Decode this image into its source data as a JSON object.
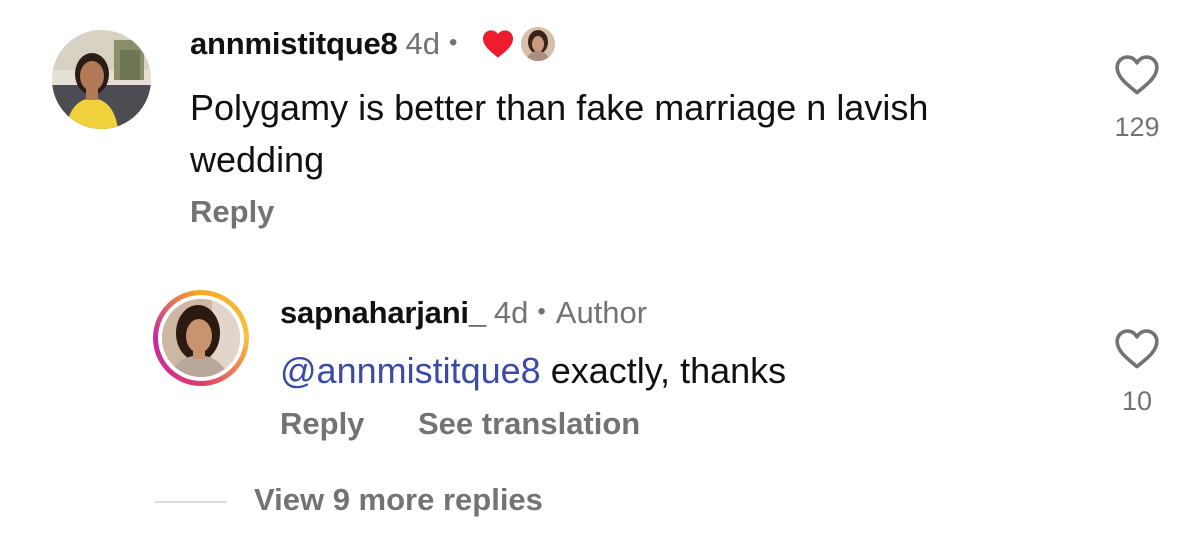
{
  "comments": [
    {
      "username": "annmistitque8",
      "age": "4d",
      "separator": "•",
      "text": "Polygamy is better than fake marriage n lavish wedding",
      "reply_label": "Reply",
      "like_count": "129",
      "badge_icon": "heart-icon",
      "accent_color": "#ed1c2e"
    }
  ],
  "reply": {
    "username": "sapnaharjani_",
    "age": "4d",
    "separator": "•",
    "role": "Author",
    "mention": "@annmistitque8",
    "text": " exactly, thanks",
    "reply_label": "Reply",
    "translation_label": "See translation",
    "like_count": "10",
    "mention_color": "#3b4aa8"
  },
  "view_more": {
    "label": "View 9 more replies"
  }
}
